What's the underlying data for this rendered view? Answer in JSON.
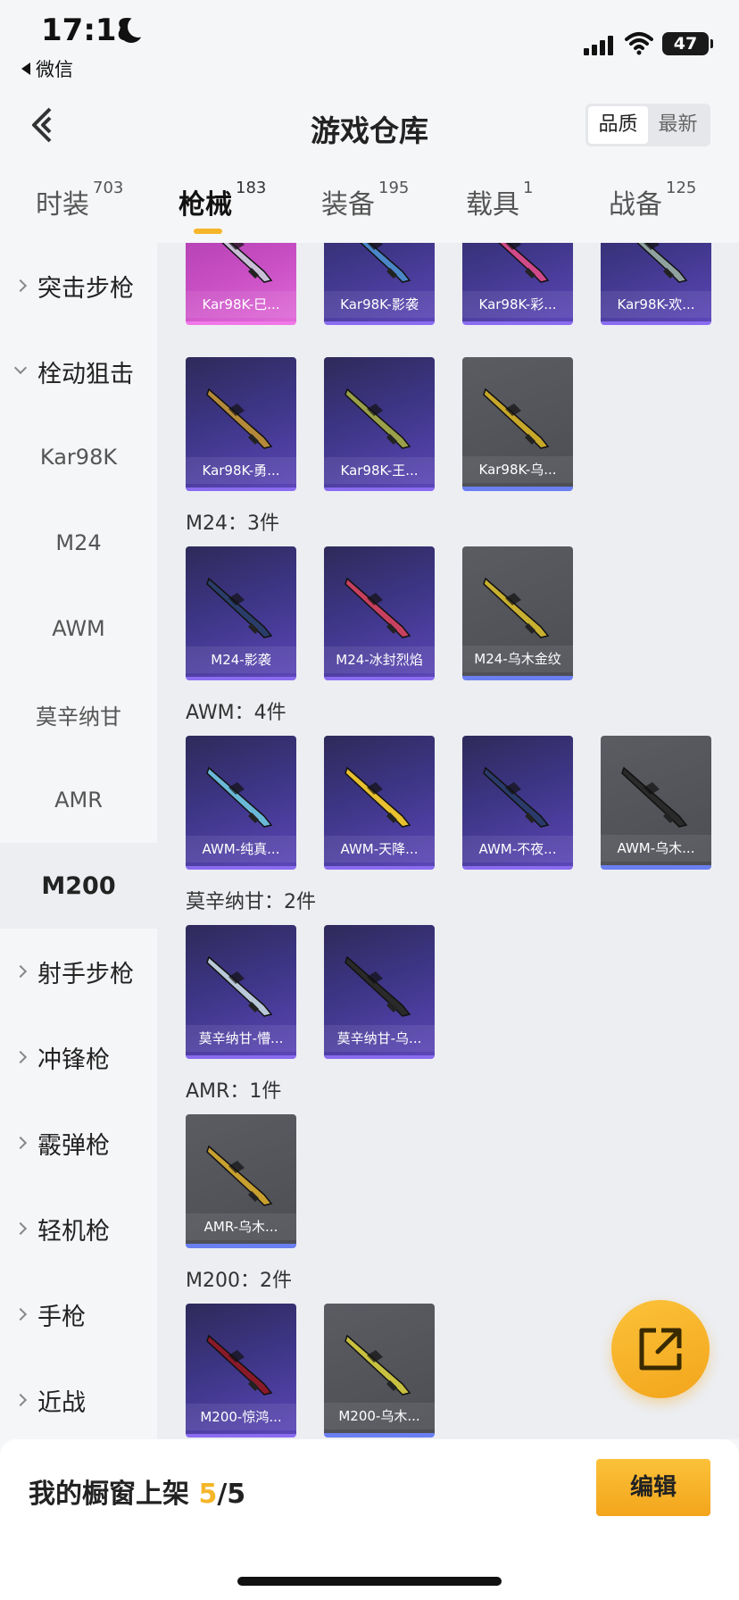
{
  "status": {
    "time": "17:18",
    "back_app": "微信",
    "battery": "47"
  },
  "header": {
    "title": "游戏仓库",
    "sort_quality": "品质",
    "sort_newest": "最新"
  },
  "tabs": [
    {
      "label": "时装",
      "count": "703"
    },
    {
      "label": "枪械",
      "count": "183"
    },
    {
      "label": "装备",
      "count": "195"
    },
    {
      "label": "载具",
      "count": "1"
    },
    {
      "label": "战备",
      "count": "125"
    }
  ],
  "sidebar": {
    "items": [
      {
        "label": "突击步枪",
        "kind": "group"
      },
      {
        "label": "栓动狙击",
        "kind": "group-open"
      },
      {
        "label": "Kar98K",
        "kind": "sub"
      },
      {
        "label": "M24",
        "kind": "sub"
      },
      {
        "label": "AWM",
        "kind": "sub"
      },
      {
        "label": "莫辛纳甘",
        "kind": "sub"
      },
      {
        "label": "AMR",
        "kind": "sub"
      },
      {
        "label": "M200",
        "kind": "selected"
      },
      {
        "label": "射手步枪",
        "kind": "group"
      },
      {
        "label": "冲锋枪",
        "kind": "group"
      },
      {
        "label": "霰弹枪",
        "kind": "group"
      },
      {
        "label": "轻机枪",
        "kind": "group"
      },
      {
        "label": "手枪",
        "kind": "group"
      },
      {
        "label": "近战",
        "kind": "group"
      }
    ]
  },
  "sections": {
    "m24": "M24：3件",
    "awm": "AWM：4件",
    "mosin": "莫辛纳甘：2件",
    "amr": "AMR：1件",
    "m200": "M200：2件"
  },
  "items": [
    {
      "label": "Kar98K-巳...",
      "rarity": "pink"
    },
    {
      "label": "Kar98K-影袭",
      "rarity": "purple"
    },
    {
      "label": "Kar98K-彩...",
      "rarity": "purple"
    },
    {
      "label": "Kar98K-欢...",
      "rarity": "purple"
    },
    {
      "label": "Kar98K-勇...",
      "rarity": "purple"
    },
    {
      "label": "Kar98K-王...",
      "rarity": "purple"
    },
    {
      "label": "Kar98K-乌...",
      "rarity": "gray"
    },
    {
      "label": "M24-影袭",
      "rarity": "purple"
    },
    {
      "label": "M24-冰封烈焰",
      "rarity": "purple"
    },
    {
      "label": "M24-乌木金纹",
      "rarity": "gray"
    },
    {
      "label": "AWM-纯真...",
      "rarity": "purple"
    },
    {
      "label": "AWM-天降...",
      "rarity": "purple"
    },
    {
      "label": "AWM-不夜...",
      "rarity": "purple"
    },
    {
      "label": "AWM-乌木...",
      "rarity": "gray"
    },
    {
      "label": "莫辛纳甘-懵...",
      "rarity": "purple"
    },
    {
      "label": "莫辛纳甘-乌...",
      "rarity": "purple"
    },
    {
      "label": "AMR-乌木...",
      "rarity": "gray"
    },
    {
      "label": "M200-惊鸿...",
      "rarity": "purple"
    },
    {
      "label": "M200-乌木...",
      "rarity": "gray"
    }
  ],
  "bottom": {
    "showcase_text": "我的橱窗上架 ",
    "showcase_used": "5",
    "showcase_total": "/5",
    "edit_label": "编辑"
  },
  "colors": {
    "accent": "#f5b62a",
    "purple_tile": "#3d3585",
    "gray_tile": "#4c4e54",
    "pink_tile": "#c84ec3"
  },
  "icons": [
    "moon-icon",
    "signal-icon",
    "wifi-icon",
    "battery-icon",
    "back-chevron-icon",
    "chevron-right-icon",
    "chevron-down-icon",
    "share-external-icon",
    "rifle-icon"
  ]
}
